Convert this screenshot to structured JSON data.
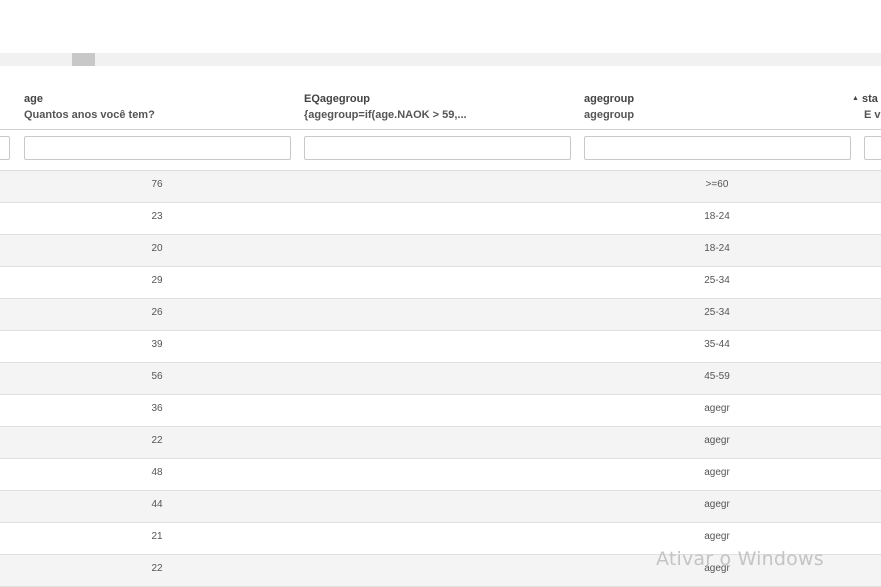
{
  "columns": [
    {
      "name": "age",
      "question": "Quantos anos você tem?"
    },
    {
      "name": "EQagegroup",
      "question": "{agegroup=if(age.NAOK > 59,..."
    },
    {
      "name": "agegroup",
      "question": "agegroup"
    },
    {
      "name": "sta",
      "question": "E v",
      "sort_indicator": "▲"
    }
  ],
  "rows": [
    {
      "age": "76",
      "eqagegroup": "",
      "agegroup": ">=60"
    },
    {
      "age": "23",
      "eqagegroup": "",
      "agegroup": "18-24"
    },
    {
      "age": "20",
      "eqagegroup": "",
      "agegroup": "18-24"
    },
    {
      "age": "29",
      "eqagegroup": "",
      "agegroup": "25-34"
    },
    {
      "age": "26",
      "eqagegroup": "",
      "agegroup": "25-34"
    },
    {
      "age": "39",
      "eqagegroup": "",
      "agegroup": "35-44"
    },
    {
      "age": "56",
      "eqagegroup": "",
      "agegroup": "45-59"
    },
    {
      "age": "36",
      "eqagegroup": "",
      "agegroup": "agegr"
    },
    {
      "age": "22",
      "eqagegroup": "",
      "agegroup": "agegr"
    },
    {
      "age": "48",
      "eqagegroup": "",
      "agegroup": "agegr"
    },
    {
      "age": "44",
      "eqagegroup": "",
      "agegroup": "agegr"
    },
    {
      "age": "21",
      "eqagegroup": "",
      "agegroup": "agegr"
    },
    {
      "age": "22",
      "eqagegroup": "",
      "agegroup": "agegr"
    }
  ],
  "watermark": "Ativar o Windows"
}
